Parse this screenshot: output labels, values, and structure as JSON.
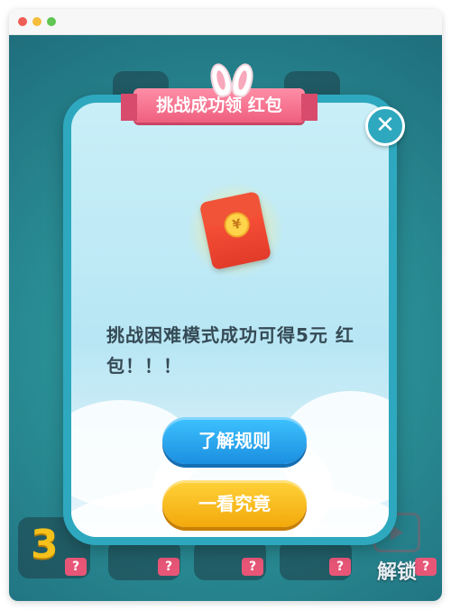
{
  "window": {
    "controls": [
      "close",
      "minimize",
      "maximize"
    ]
  },
  "colors": {
    "close_dot": "#ee5f57",
    "minimize_dot": "#f4bd3b",
    "maximize_dot": "#61c554"
  },
  "modal": {
    "ribbon_title": "挑战成功领 红包",
    "message": "挑战困难模式成功可得5元 红包！！！",
    "primary_button": "了解规则",
    "secondary_button": "一看究竟",
    "close_icon_glyph": "✕",
    "coin_glyph": "¥"
  },
  "background": {
    "level_number": "3",
    "unlock_label": "解锁",
    "question_mark": "?"
  }
}
